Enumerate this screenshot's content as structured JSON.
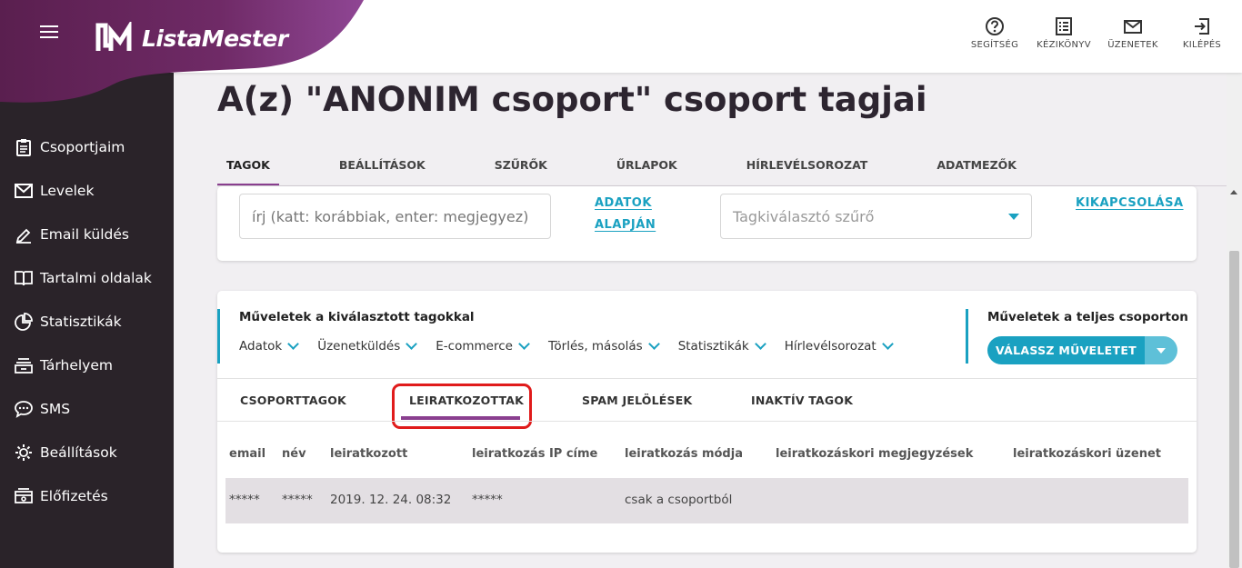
{
  "app": {
    "name": "ListaMester"
  },
  "header": {
    "actions": [
      {
        "label": "SEGÍTSÉG",
        "icon": "help-circle-icon"
      },
      {
        "label": "KÉZIKÖNYV",
        "icon": "manual-list-icon"
      },
      {
        "label": "ÜZENETEK",
        "icon": "envelope-icon"
      },
      {
        "label": "KILÉPÉS",
        "icon": "logout-icon"
      }
    ]
  },
  "sidebar": {
    "items": [
      {
        "label": "Csoportjaim",
        "icon": "clipboard-icon"
      },
      {
        "label": "Levelek",
        "icon": "envelope-icon"
      },
      {
        "label": "Email küldés",
        "icon": "pen-icon"
      },
      {
        "label": "Tartalmi oldalak",
        "icon": "book-icon"
      },
      {
        "label": "Statisztikák",
        "icon": "pie-chart-icon"
      },
      {
        "label": "Tárhelyem",
        "icon": "storage-icon"
      },
      {
        "label": "SMS",
        "icon": "chat-bubble-icon"
      },
      {
        "label": "Beállítások",
        "icon": "gear-icon"
      },
      {
        "label": "Előfizetés",
        "icon": "subscription-icon"
      }
    ]
  },
  "page": {
    "title": "A(z) \"ANONIM csoport\" csoport tagjai",
    "tabs": [
      "TAGOK",
      "BEÁLLÍTÁSOK",
      "SZŰRŐK",
      "ŰRLAPOK",
      "HÍRLEVÉLSOROZAT",
      "ADATMEZŐK"
    ],
    "active_tab": "TAGOK"
  },
  "filters": {
    "search_placeholder": "írj (katt: korábbiak, enter: megjegyez)",
    "link_data_1": "ADATOK",
    "link_data_2": "ALAPJÁN",
    "tag_filter_placeholder": "Tagkiválasztó szűrő",
    "link_disable": "KIKAPCSOLÁSA"
  },
  "operations": {
    "selected_title": "Műveletek a kiválasztott tagokkal",
    "menu": [
      "Adatok",
      "Üzenetküldés",
      "E-commerce",
      "Törlés, másolás",
      "Statisztikák",
      "Hírlevélsorozat"
    ],
    "group_title": "Műveletek a teljes csoporton",
    "group_button": "VÁLASSZ MŰVELETET"
  },
  "subtabs": {
    "items": [
      "CSOPORTTAGOK",
      "LEIRATKOZOTTAK",
      "SPAM JELÖLÉSEK",
      "INAKTÍV TAGOK"
    ],
    "active": "LEIRATKOZOTTAK"
  },
  "table": {
    "columns": [
      "email",
      "név",
      "leiratkozott",
      "leiratkozás IP címe",
      "leiratkozás módja",
      "leiratkozáskori megjegyzések",
      "leiratkozáskori üzenet"
    ],
    "rows": [
      [
        "*****",
        "*****",
        "2019. 12. 24. 08:32",
        "*****",
        "csak a csoportból",
        "",
        ""
      ]
    ]
  },
  "colors": {
    "brand_purple": "#8a3f8f",
    "accent_teal": "#1aa1c1",
    "sidebar_bg": "#2a2329",
    "highlight_red": "#e01b1b"
  }
}
